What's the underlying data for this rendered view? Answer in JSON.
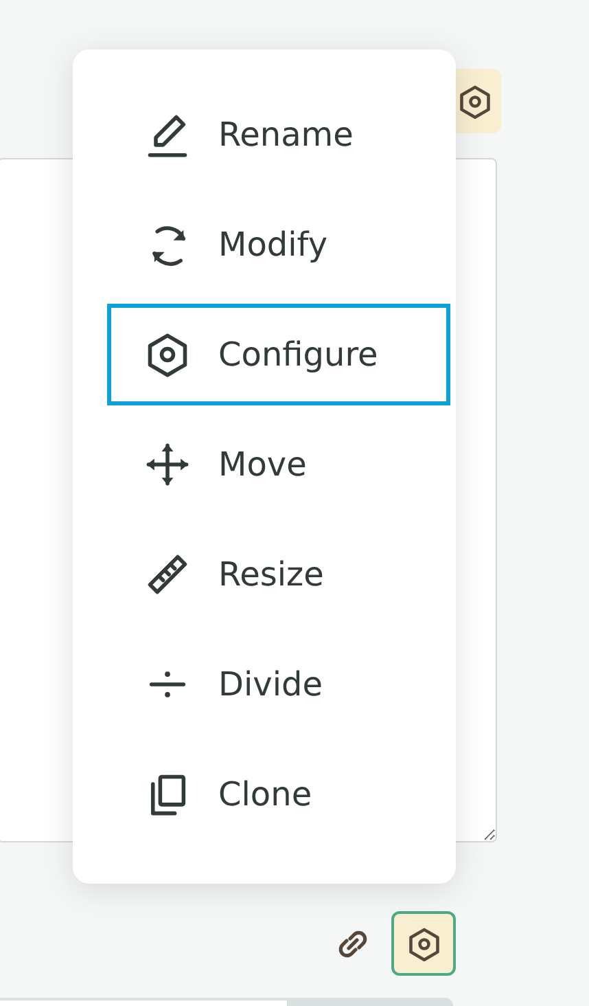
{
  "top_toolbar": {
    "settings_button": {
      "active": false
    }
  },
  "menu": {
    "items": [
      {
        "label": "Rename",
        "kind": "pencil",
        "focused": false
      },
      {
        "label": "Modify",
        "kind": "cycle",
        "focused": false
      },
      {
        "label": "Configure",
        "kind": "hex",
        "focused": true
      },
      {
        "label": "Move",
        "kind": "move",
        "focused": false
      },
      {
        "label": "Resize",
        "kind": "ruler",
        "focused": false
      },
      {
        "label": "Divide",
        "kind": "divide",
        "focused": false
      },
      {
        "label": "Clone",
        "kind": "copy",
        "focused": false
      }
    ]
  },
  "bottom_toolbar": {
    "settings_button": {
      "active": true
    }
  }
}
